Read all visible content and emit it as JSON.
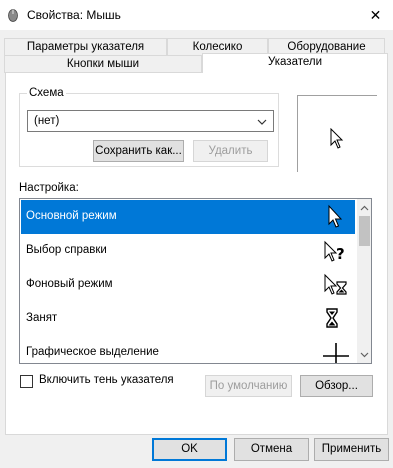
{
  "window": {
    "title": "Свойства: Мышь",
    "close_glyph": "✕"
  },
  "tabs": {
    "row1": [
      "Параметры указателя",
      "Колесико",
      "Оборудование"
    ],
    "row2": [
      "Кнопки мыши",
      "Указатели"
    ],
    "active": "Указатели"
  },
  "scheme": {
    "label": "Схема",
    "selected": "(нет)",
    "save_as": "Сохранить как...",
    "delete": "Удалить"
  },
  "settings": {
    "label": "Настройка:",
    "items": [
      {
        "label": "Основной режим",
        "icon": "arrow-cursor-icon",
        "selected": true
      },
      {
        "label": "Выбор справки",
        "icon": "help-select-cursor-icon",
        "selected": false
      },
      {
        "label": "Фоновый режим",
        "icon": "working-in-background-cursor-icon",
        "selected": false
      },
      {
        "label": "Занят",
        "icon": "busy-hourglass-cursor-icon",
        "selected": false
      },
      {
        "label": "Графическое выделение",
        "icon": "precision-crosshair-cursor-icon",
        "selected": false
      }
    ]
  },
  "shadow": {
    "label": "Включить тень указателя",
    "checked": false
  },
  "actions": {
    "default": "По умолчанию",
    "browse": "Обзор..."
  },
  "footer": {
    "ok": "OK",
    "cancel": "Отмена",
    "apply": "Применить"
  },
  "colors": {
    "selection": "#0078d7",
    "dialog_bg": "#f0f0f0",
    "accent_border": "#0078d7"
  }
}
